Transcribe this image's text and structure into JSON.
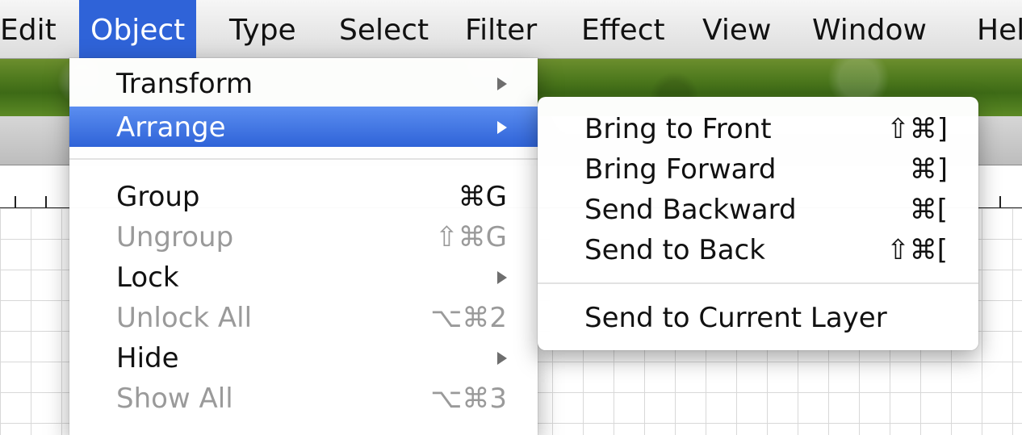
{
  "menubar": {
    "items": [
      "Edit",
      "Object",
      "Type",
      "Select",
      "Filter",
      "Effect",
      "View",
      "Window",
      "Help"
    ],
    "active": "Object"
  },
  "object_menu": {
    "items": [
      {
        "label": "Transform",
        "submenu": true,
        "enabled": true
      },
      {
        "label": "Arrange",
        "submenu": true,
        "enabled": true,
        "highlighted": true
      },
      {
        "label": "Group",
        "shortcut": "⌘G",
        "enabled": true
      },
      {
        "label": "Ungroup",
        "shortcut": "⇧⌘G",
        "enabled": false
      },
      {
        "label": "Lock",
        "submenu": true,
        "enabled": true
      },
      {
        "label": "Unlock All",
        "shortcut": "⌥⌘2",
        "enabled": false
      },
      {
        "label": "Hide",
        "submenu": true,
        "enabled": true
      },
      {
        "label": "Show All",
        "shortcut": "⌥⌘3",
        "enabled": false
      }
    ]
  },
  "arrange_menu": {
    "items": [
      {
        "label": "Bring to Front",
        "shortcut": "⇧⌘]"
      },
      {
        "label": "Bring Forward",
        "shortcut": "⌘]"
      },
      {
        "label": "Send Backward",
        "shortcut": "⌘["
      },
      {
        "label": "Send to Back",
        "shortcut": "⇧⌘["
      },
      {
        "label": "Send to Current Layer",
        "shortcut": ""
      }
    ]
  },
  "colors": {
    "highlight": "#2f63d8",
    "disabled_text": "#9a9a9a"
  },
  "icons": {
    "submenu_arrow": "triangle-right-icon"
  }
}
